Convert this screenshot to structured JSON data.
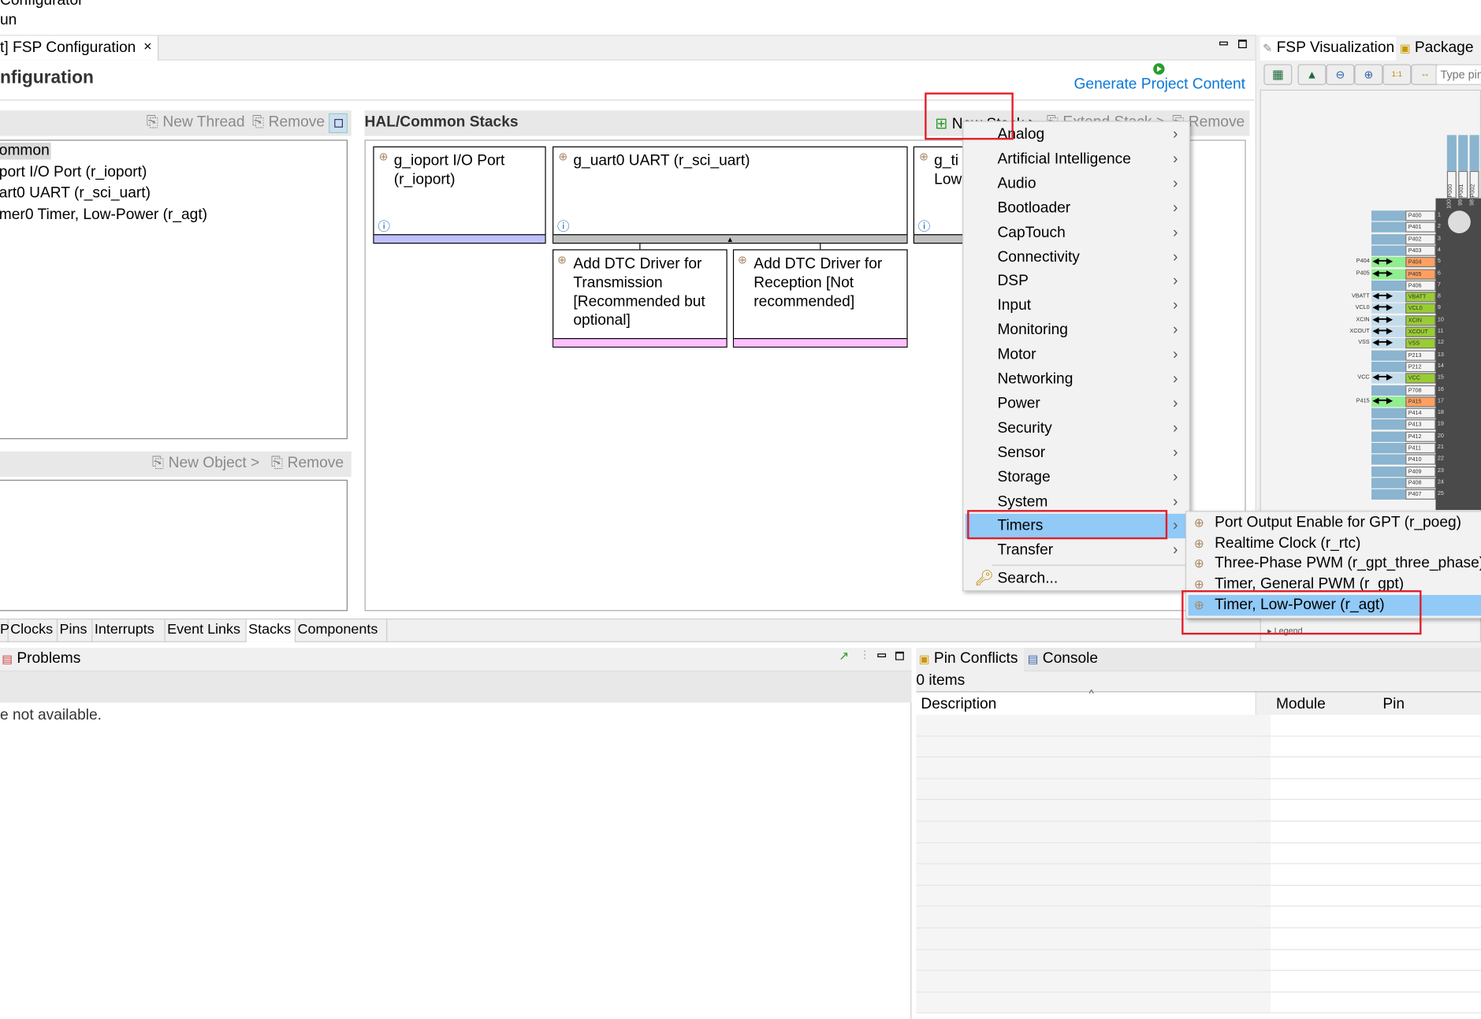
{
  "top_lines": {
    "line1": "Configurator",
    "line2": "un"
  },
  "editor": {
    "tab_label": "t] FSP Configuration",
    "tab_close": "×",
    "page_title": "nfiguration",
    "generate_link": "Generate Project Content"
  },
  "threads": {
    "new_thread": "New Thread",
    "remove": "Remove",
    "items": [
      "ommon",
      "port I/O Port (r_ioport)",
      "art0 UART (r_sci_uart)",
      "mer0 Timer, Low-Power (r_agt)"
    ]
  },
  "objects": {
    "new_object": "New Object >",
    "remove": "Remove"
  },
  "stacks": {
    "title": "HAL/Common Stacks",
    "new_stack": "New Stack >",
    "extend_stack": "Extend Stack >",
    "remove": "Remove",
    "modules": [
      {
        "title": "g_ioport I/O Port (r_ioport)",
        "color": "#c0c0ff"
      },
      {
        "title": "g_uart0 UART (r_sci_uart)",
        "color": "#c0c0c0"
      },
      {
        "title": "g_timer0 Timer, Low-Power (r_agt)",
        "visible": "g_ti Low",
        "color": "#c0c0c0"
      }
    ],
    "dependencies": [
      {
        "title": "Add DTC Driver for Transmission [Recommended but optional]",
        "color": "#ffc0ff"
      },
      {
        "title": "Add DTC Driver for Reception [Not recommended]",
        "color": "#ffc0ff"
      }
    ]
  },
  "context_menu": {
    "items": [
      "Analog",
      "Artificial Intelligence",
      "Audio",
      "Bootloader",
      "CapTouch",
      "Connectivity",
      "DSP",
      "Input",
      "Monitoring",
      "Motor",
      "Networking",
      "Power",
      "Security",
      "Sensor",
      "Storage",
      "System",
      "Timers",
      "Transfer"
    ],
    "selected": "Timers",
    "search": "Search..."
  },
  "submenu": {
    "items": [
      "Port Output Enable for GPT (r_poeg)",
      "Realtime Clock (r_rtc)",
      "Three-Phase PWM (r_gpt_three_phase)",
      "Timer, General PWM (r_gpt)",
      "Timer, Low-Power (r_agt)"
    ],
    "selected": "Timer, Low-Power (r_agt)"
  },
  "bottom_tabs": [
    "P",
    "Clocks",
    "Pins",
    "Interrupts",
    "Event Links",
    "Stacks",
    "Components"
  ],
  "active_bottom_tab": "Stacks",
  "problems": {
    "tab": "Problems",
    "message": "e not available."
  },
  "pin_conflicts": {
    "tab": "Pin Conflicts",
    "console_tab": "Console",
    "count": "0 items",
    "columns": [
      "Description",
      "Module",
      "Pin"
    ]
  },
  "visualization": {
    "tab": "FSP Visualization",
    "package_tab": "Package",
    "search_placeholder": "Type pin",
    "legend": "Legend",
    "top_pins": [
      {
        "name": "P000",
        "num": "100"
      },
      {
        "name": "P001",
        "num": "99"
      },
      {
        "name": "P002",
        "num": "98"
      }
    ],
    "pins": [
      {
        "num": "1",
        "name": "P400",
        "state": "free"
      },
      {
        "num": "2",
        "name": "P401",
        "state": "free"
      },
      {
        "num": "3",
        "name": "P402",
        "state": "free"
      },
      {
        "num": "4",
        "name": "P403",
        "state": "free"
      },
      {
        "num": "5",
        "name": "P404",
        "state": "used",
        "label": "P404"
      },
      {
        "num": "6",
        "name": "P405",
        "state": "used",
        "label": "P405"
      },
      {
        "num": "7",
        "name": "P406",
        "state": "free"
      },
      {
        "num": "8",
        "name": "VBATT",
        "state": "power",
        "label": "VBATT"
      },
      {
        "num": "9",
        "name": "VCL0",
        "state": "power",
        "label": "VCL0"
      },
      {
        "num": "10",
        "name": "XCIN",
        "state": "power",
        "label": "XCIN"
      },
      {
        "num": "11",
        "name": "XCOUT",
        "state": "power",
        "label": "XCOUT"
      },
      {
        "num": "12",
        "name": "VSS",
        "state": "power",
        "label": "VSS"
      },
      {
        "num": "13",
        "name": "P213",
        "state": "free"
      },
      {
        "num": "14",
        "name": "P212",
        "state": "free"
      },
      {
        "num": "15",
        "name": "VCC",
        "state": "power",
        "label": "VCC"
      },
      {
        "num": "16",
        "name": "P708",
        "state": "free"
      },
      {
        "num": "17",
        "name": "P415",
        "state": "used",
        "label": "P415"
      },
      {
        "num": "18",
        "name": "P414",
        "state": "free"
      },
      {
        "num": "19",
        "name": "P413",
        "state": "free"
      },
      {
        "num": "20",
        "name": "P412",
        "state": "free"
      },
      {
        "num": "21",
        "name": "P411",
        "state": "free"
      },
      {
        "num": "22",
        "name": "P410",
        "state": "free"
      },
      {
        "num": "23",
        "name": "P409",
        "state": "free"
      },
      {
        "num": "24",
        "name": "P408",
        "state": "free"
      },
      {
        "num": "25",
        "name": "P407",
        "state": "free"
      }
    ]
  },
  "colors": {
    "link": "#0a78d7",
    "highlight": "#91c9f7",
    "annotation_red": "#e0202a",
    "pin_used": "#ffa060",
    "pin_power": "#99cc33",
    "pin_free_bar": "#8ab4cf",
    "chip": "#4a4a4a"
  }
}
